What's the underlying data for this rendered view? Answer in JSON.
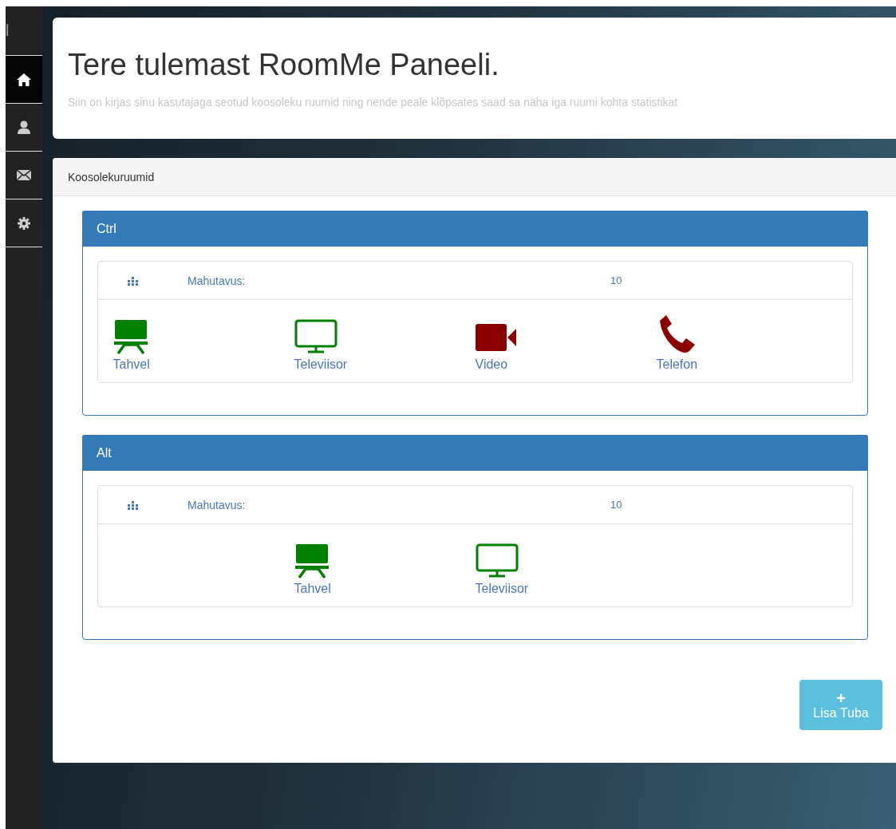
{
  "sidebar": {
    "brand": "l",
    "items": [
      {
        "kind": "home",
        "selected": true
      },
      {
        "kind": "user",
        "selected": false
      },
      {
        "kind": "mail",
        "selected": false
      },
      {
        "kind": "settings",
        "selected": false
      }
    ]
  },
  "welcome": {
    "title": "Tere tulemast RoomMe Paneeli.",
    "subtitle": "Siin on kirjas sinu kasutajaga seotud koosoleku ruumid ning nende peale klõpsates saad sa näha iga ruumi kohta statistikat"
  },
  "rooms_panel": {
    "title": "Koosolekuruumid",
    "rooms": [
      {
        "name": "Ctrl",
        "capacity_label": "Mahutavus:",
        "capacity": "10",
        "equipment": [
          {
            "kind": "board",
            "label": "Tahvel",
            "available": true
          },
          {
            "kind": "tv",
            "label": "Televiisor",
            "available": true
          },
          {
            "kind": "video",
            "label": "Video",
            "available": false
          },
          {
            "kind": "phone",
            "label": "Telefon",
            "available": false
          }
        ]
      },
      {
        "name": "Alt",
        "capacity_label": "Mahutavus:",
        "capacity": "10",
        "equipment": [
          {
            "kind": "board",
            "label": "Tahvel",
            "available": true
          },
          {
            "kind": "tv",
            "label": "Televiisor",
            "available": true
          }
        ]
      }
    ],
    "add_button": {
      "icon": "+",
      "label": "Lisa Tuba"
    }
  }
}
